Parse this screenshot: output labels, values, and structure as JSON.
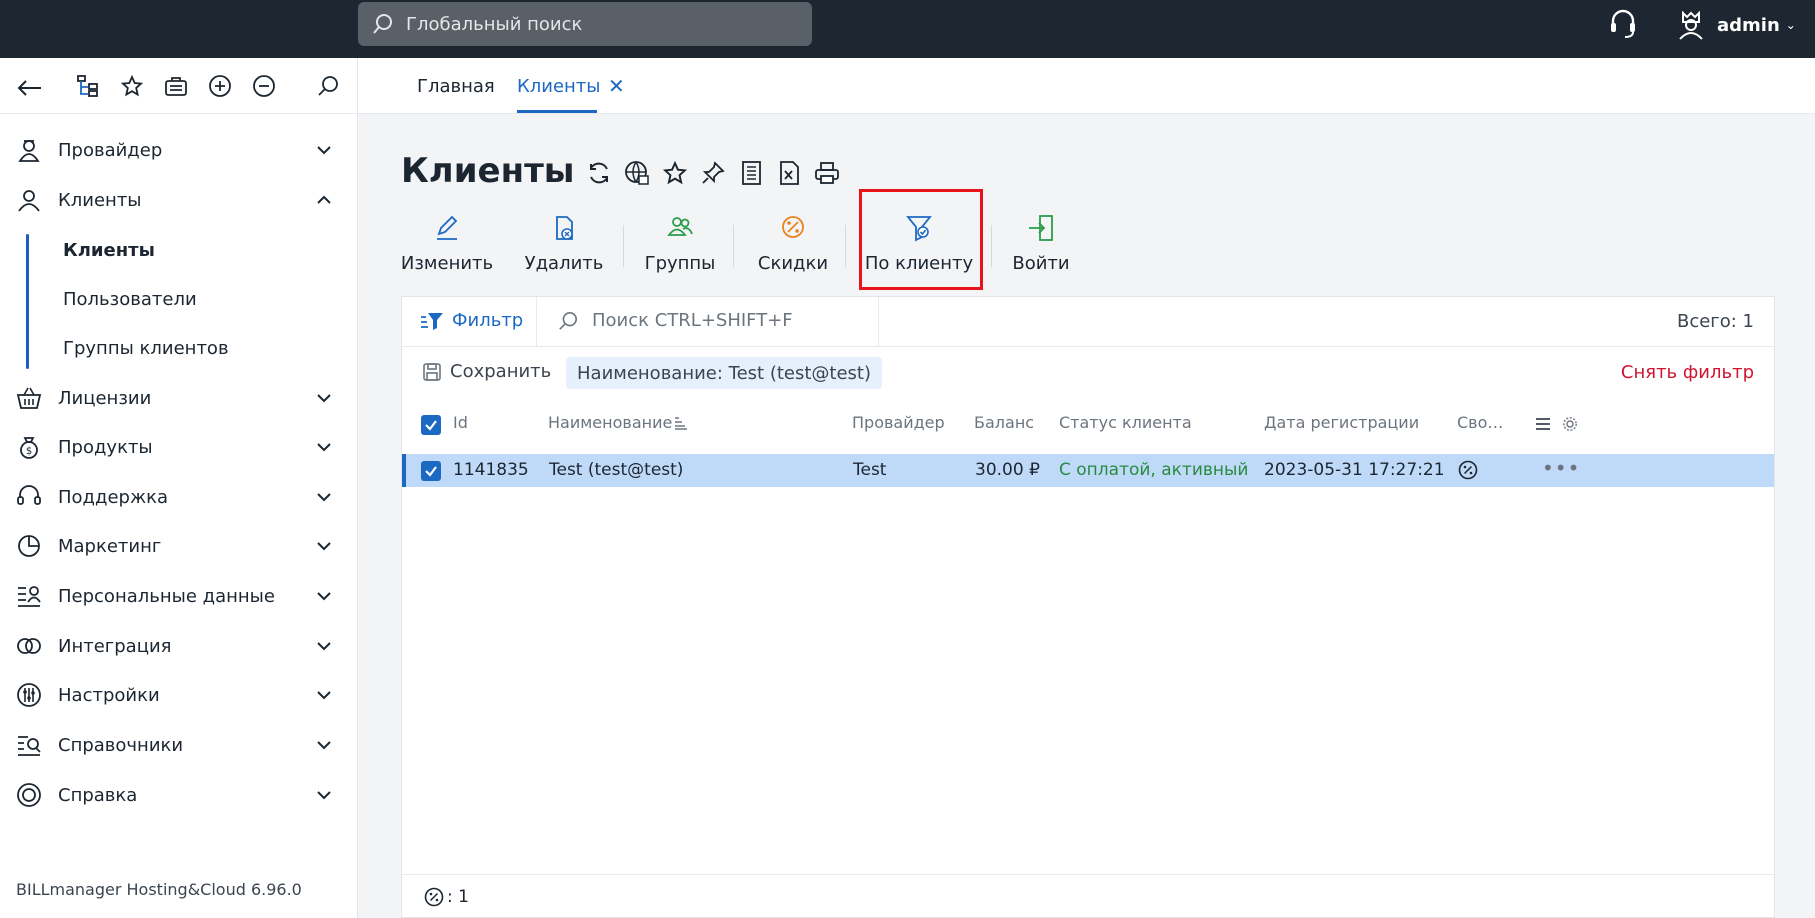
{
  "topbar": {
    "search_placeholder": "Глобальный поиск",
    "username": "admin"
  },
  "sidebar": {
    "items": [
      {
        "label": "Провайдер",
        "icon": "provider-icon",
        "expanded": false
      },
      {
        "label": "Клиенты",
        "icon": "clients-icon",
        "expanded": true
      },
      {
        "label": "Лицензии",
        "icon": "basket-icon",
        "expanded": false
      },
      {
        "label": "Продукты",
        "icon": "money-bag-icon",
        "expanded": false
      },
      {
        "label": "Поддержка",
        "icon": "headset-icon",
        "expanded": false
      },
      {
        "label": "Маркетинг",
        "icon": "pie-chart-icon",
        "expanded": false
      },
      {
        "label": "Персональные данные",
        "icon": "personal-data-icon",
        "expanded": false
      },
      {
        "label": "Интеграция",
        "icon": "integration-icon",
        "expanded": false
      },
      {
        "label": "Настройки",
        "icon": "settings-sliders-icon",
        "expanded": false
      },
      {
        "label": "Справочники",
        "icon": "reference-icon",
        "expanded": false
      },
      {
        "label": "Справка",
        "icon": "lifebuoy-icon",
        "expanded": false
      }
    ],
    "subitems": [
      {
        "label": "Клиенты",
        "active": true
      },
      {
        "label": "Пользователи",
        "active": false
      },
      {
        "label": "Группы клиентов",
        "active": false
      }
    ],
    "version": "BILLmanager Hosting&Cloud 6.96.0"
  },
  "tabs": {
    "home": "Главная",
    "clients": "Клиенты"
  },
  "page": {
    "title": "Клиенты"
  },
  "toolbar": {
    "edit": "Изменить",
    "delete": "Удалить",
    "groups": "Группы",
    "discounts": "Скидки",
    "by_client": "По клиенту",
    "login": "Войти"
  },
  "filter": {
    "label": "Фильтр",
    "search_placeholder": "Поиск CTRL+SHIFT+F",
    "total": "Всего: 1",
    "save": "Сохранить",
    "chip": "Наименование: Test (test@test)",
    "clear": "Снять фильтр"
  },
  "table": {
    "columns": {
      "id": "Id",
      "name": "Наименование",
      "provider": "Провайдер",
      "balance": "Баланс",
      "status": "Статус клиента",
      "regdate": "Дата регистрации",
      "props": "Сво…"
    },
    "rows": [
      {
        "id": "1141835",
        "name": "Test (test@test)",
        "provider": "Test",
        "balance": "30.00 ₽",
        "status": "С оплатой, активный",
        "regdate": "2023-05-31 17:27:21"
      }
    ]
  },
  "footer": {
    "count": ": 1"
  },
  "colors": {
    "accent": "#1c69c4",
    "topbar": "#1d2631",
    "selected_row": "#bfdaf9",
    "status_green": "#2a8a3e",
    "danger": "#d0142f",
    "highlight": "#e8141c"
  }
}
